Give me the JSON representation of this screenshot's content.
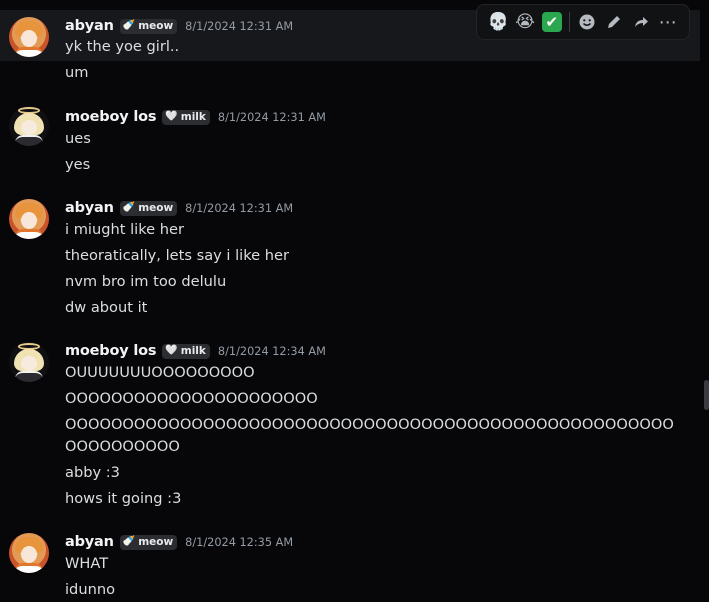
{
  "toolbar": {
    "reactions": [
      "💀",
      "😭",
      "✔"
    ],
    "icons": [
      "smile-add-icon",
      "pencil-icon",
      "reply-forward-icon",
      "more-icon"
    ],
    "more": "⋯"
  },
  "groups": [
    {
      "author": "abyan",
      "tag": "meow",
      "tag_icon": "🍼",
      "timestamp": "8/1/2024 12:31 AM",
      "messages": [
        "yk the yoe girl..",
        "um"
      ]
    },
    {
      "author": "moeboy los",
      "tag": "milk",
      "tag_icon": "🤍",
      "timestamp": "8/1/2024 12:31 AM",
      "messages": [
        "ues",
        "yes"
      ]
    },
    {
      "author": "abyan",
      "tag": "meow",
      "tag_icon": "🍼",
      "timestamp": "8/1/2024 12:31 AM",
      "messages": [
        "i miught like her",
        "theoratically, lets say i like her",
        "nvm bro im too delulu",
        "dw about it"
      ]
    },
    {
      "author": "moeboy los",
      "tag": "milk",
      "tag_icon": "🤍",
      "timestamp": "8/1/2024 12:34 AM",
      "messages": [
        "OUUUUUUUOOOOOOOOO",
        "OOOOOOOOOOOOOOOOOOOOOO",
        "OOOOOOOOOOOOOOOOOOOOOOOOOOOOOOOOOOOOOOOOOOOOOOOOOOOOOOOOOOOOOOO",
        "abby :3",
        "hows it going :3"
      ]
    },
    {
      "author": "abyan",
      "tag": "meow",
      "tag_icon": "🍼",
      "timestamp": "8/1/2024 12:35 AM",
      "messages": [
        "WHAT",
        "idunno"
      ]
    }
  ]
}
